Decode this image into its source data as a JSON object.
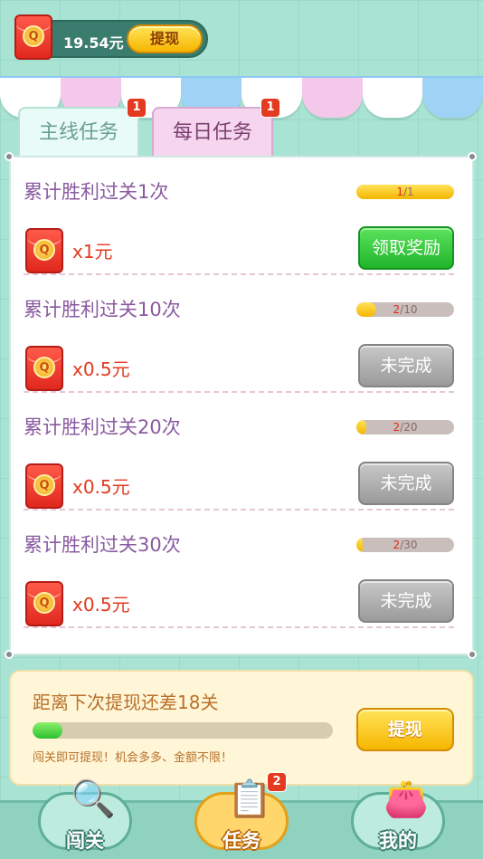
{
  "header": {
    "balance": "19.54元",
    "withdraw_label": "提现"
  },
  "colors": {
    "awning_pink": "#f4c8ea",
    "awning_white": "#ffffff",
    "awning_blue": "#9fd3f6",
    "claim_green": "#1fb52a",
    "incomplete_gray": "#9a9a9a"
  },
  "tabs": [
    {
      "label": "主线任务",
      "badge": "1",
      "selected": false
    },
    {
      "label": "每日任务",
      "badge": "1",
      "selected": true
    }
  ],
  "tasks": [
    {
      "title": "累计胜利过关1次",
      "progress_current": "1",
      "progress_total": "/1",
      "progress_fraction": 1.0,
      "reward": "x1元",
      "button": "领取奖励",
      "state": "claimable"
    },
    {
      "title": "累计胜利过关10次",
      "progress_current": "2",
      "progress_total": "/10",
      "progress_fraction": 0.2,
      "reward": "x0.5元",
      "button": "未完成",
      "state": "incomplete"
    },
    {
      "title": "累计胜利过关20次",
      "progress_current": "2",
      "progress_total": "/20",
      "progress_fraction": 0.1,
      "reward": "x0.5元",
      "button": "未完成",
      "state": "incomplete"
    },
    {
      "title": "累计胜利过关30次",
      "progress_current": "2",
      "progress_total": "/30",
      "progress_fraction": 0.067,
      "reward": "x0.5元",
      "button": "未完成",
      "state": "incomplete"
    }
  ],
  "withdraw_card": {
    "title": "距离下次提现还差18关",
    "progress_fraction": 0.1,
    "button": "提现",
    "tip": "闯关即可提现！机会多多、金额不限！"
  },
  "nav": {
    "items": [
      {
        "label": "闯关",
        "icon": "magnifier-icon"
      },
      {
        "label": "任务",
        "icon": "clipboard-icon",
        "badge": "2",
        "active": true
      },
      {
        "label": "我的",
        "icon": "wallet-icon"
      }
    ]
  }
}
